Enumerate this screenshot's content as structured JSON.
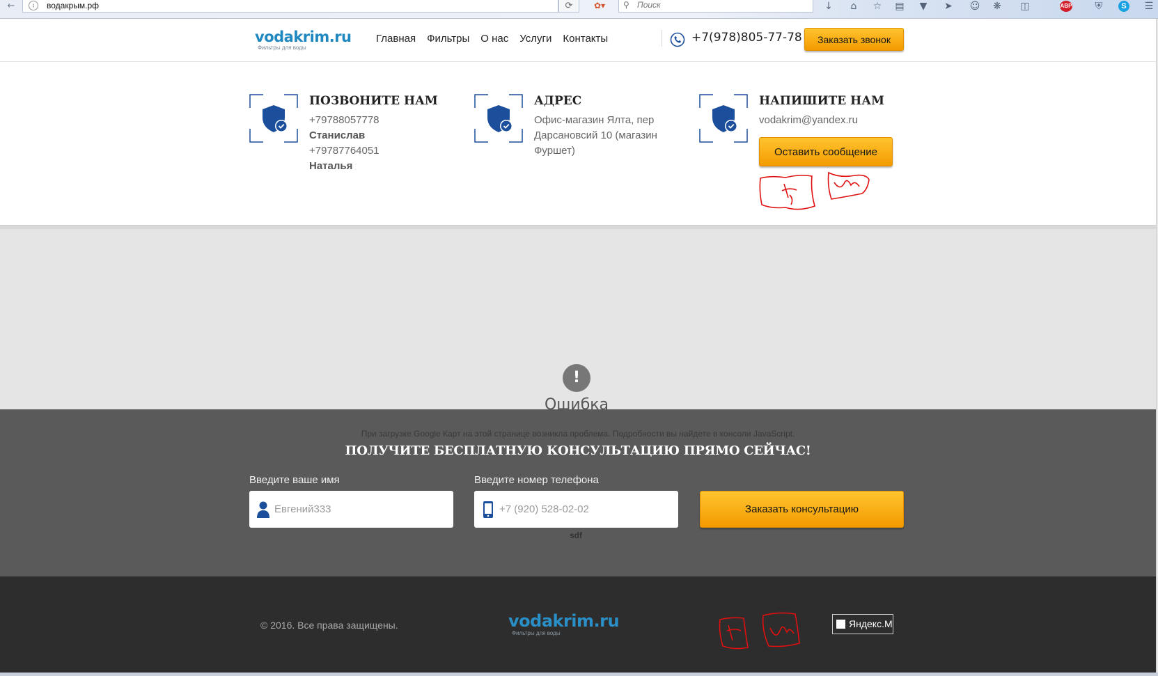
{
  "browser": {
    "url": "водакрым.рф",
    "search_placeholder": "Поиск"
  },
  "header": {
    "logo": "vodakrim.ru",
    "logo_sub": "Фильтры для воды",
    "nav": [
      "Главная",
      "Фильтры",
      "О нас",
      "Услуги",
      "Контакты"
    ],
    "phone": "+7(978)805-77-78",
    "callback_label": "Заказать звонок"
  },
  "contacts": {
    "call": {
      "title": "ПОЗВОНИТЕ НАМ",
      "phone1": "+79788057778",
      "name1": "Станислав",
      "phone2": "+79787764051",
      "name2": "Наталья"
    },
    "address": {
      "title": "АДРЕС",
      "line1": "Офис-магазин Ялта, пер",
      "line2": "Дарсановсий 10 (магазин",
      "line3": "Фуршет)"
    },
    "write": {
      "title": "НАПИШИТЕ НАМ",
      "email": "vodakrim@yandex.ru",
      "button": "Оставить сообщение"
    }
  },
  "map": {
    "error_icon": "!",
    "error_title": "Ошибка",
    "error_message": "При загрузке Google Карт на этой странице возникла проблема. Подробности вы найдете в консоли JavaScript."
  },
  "consultation": {
    "title": "ПОЛУЧИТЕ БЕСПЛАТНУЮ КОНСУЛЬТАЦИЮ ПРЯМО СЕЙЧАС!",
    "name_label": "Введите ваше имя",
    "name_value": "Евгений333",
    "phone_label": "Введите номер телефона",
    "phone_placeholder": "+7 (920) 528-02-02",
    "submit": "Заказать консультацию",
    "stray_text": "sdf"
  },
  "footer": {
    "copyright": "© 2016. Все права защищены.",
    "logo": "vodakrim.ru",
    "logo_sub": "Фильтры для воды",
    "yandex_badge": "Яндекс.М"
  },
  "colors": {
    "accent_orange": "#f7a500",
    "brand_blue": "#1f88c0",
    "icon_blue": "#1b4f9c"
  }
}
